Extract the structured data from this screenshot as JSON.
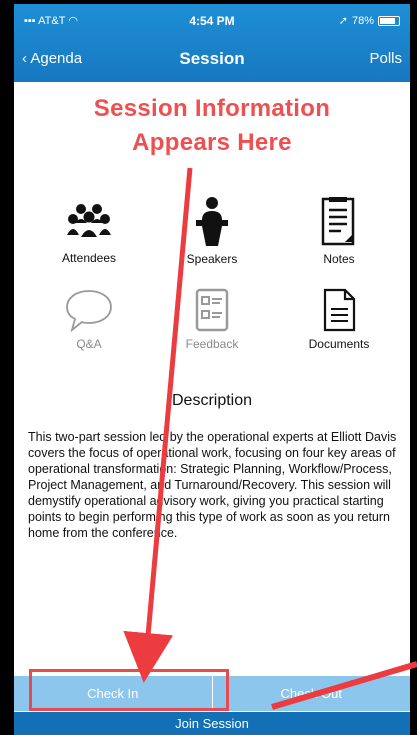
{
  "status": {
    "carrier": "AT&T",
    "time": "4:54 PM",
    "battery": "78%"
  },
  "nav": {
    "back_label": "Agenda",
    "title": "Session",
    "right_label": "Polls"
  },
  "annotation": {
    "line1": "Session Information",
    "line2": "Appears Here"
  },
  "tiles": [
    {
      "label": "Attendees",
      "icon": "attendees-icon"
    },
    {
      "label": "Speakers",
      "icon": "speaker-podium-icon"
    },
    {
      "label": "Notes",
      "icon": "notes-icon"
    },
    {
      "label": "Q&A",
      "icon": "speech-bubble-icon"
    },
    {
      "label": "Feedback",
      "icon": "feedback-form-icon"
    },
    {
      "label": "Documents",
      "icon": "document-icon"
    }
  ],
  "description": {
    "heading": "Description",
    "body": "This two-part session led by the operational experts at Elliott Davis covers the focus of operational work, focusing on four key areas of operational transformation:  Strategic Planning, Workflow/Process, Project Management, and Turnaround/Recovery. This session will demystify operational advisory work, giving you practical starting points to begin performing this type of work as soon as you return home from the conference."
  },
  "buttons": {
    "check_in": "Check In",
    "check_out": "Check Out",
    "join": "Join Session"
  },
  "colors": {
    "nav_blue": "#1778c0",
    "button_light_blue": "#8dc6ec",
    "join_blue": "#1470b6",
    "annotation_red": "#ef4f51"
  }
}
